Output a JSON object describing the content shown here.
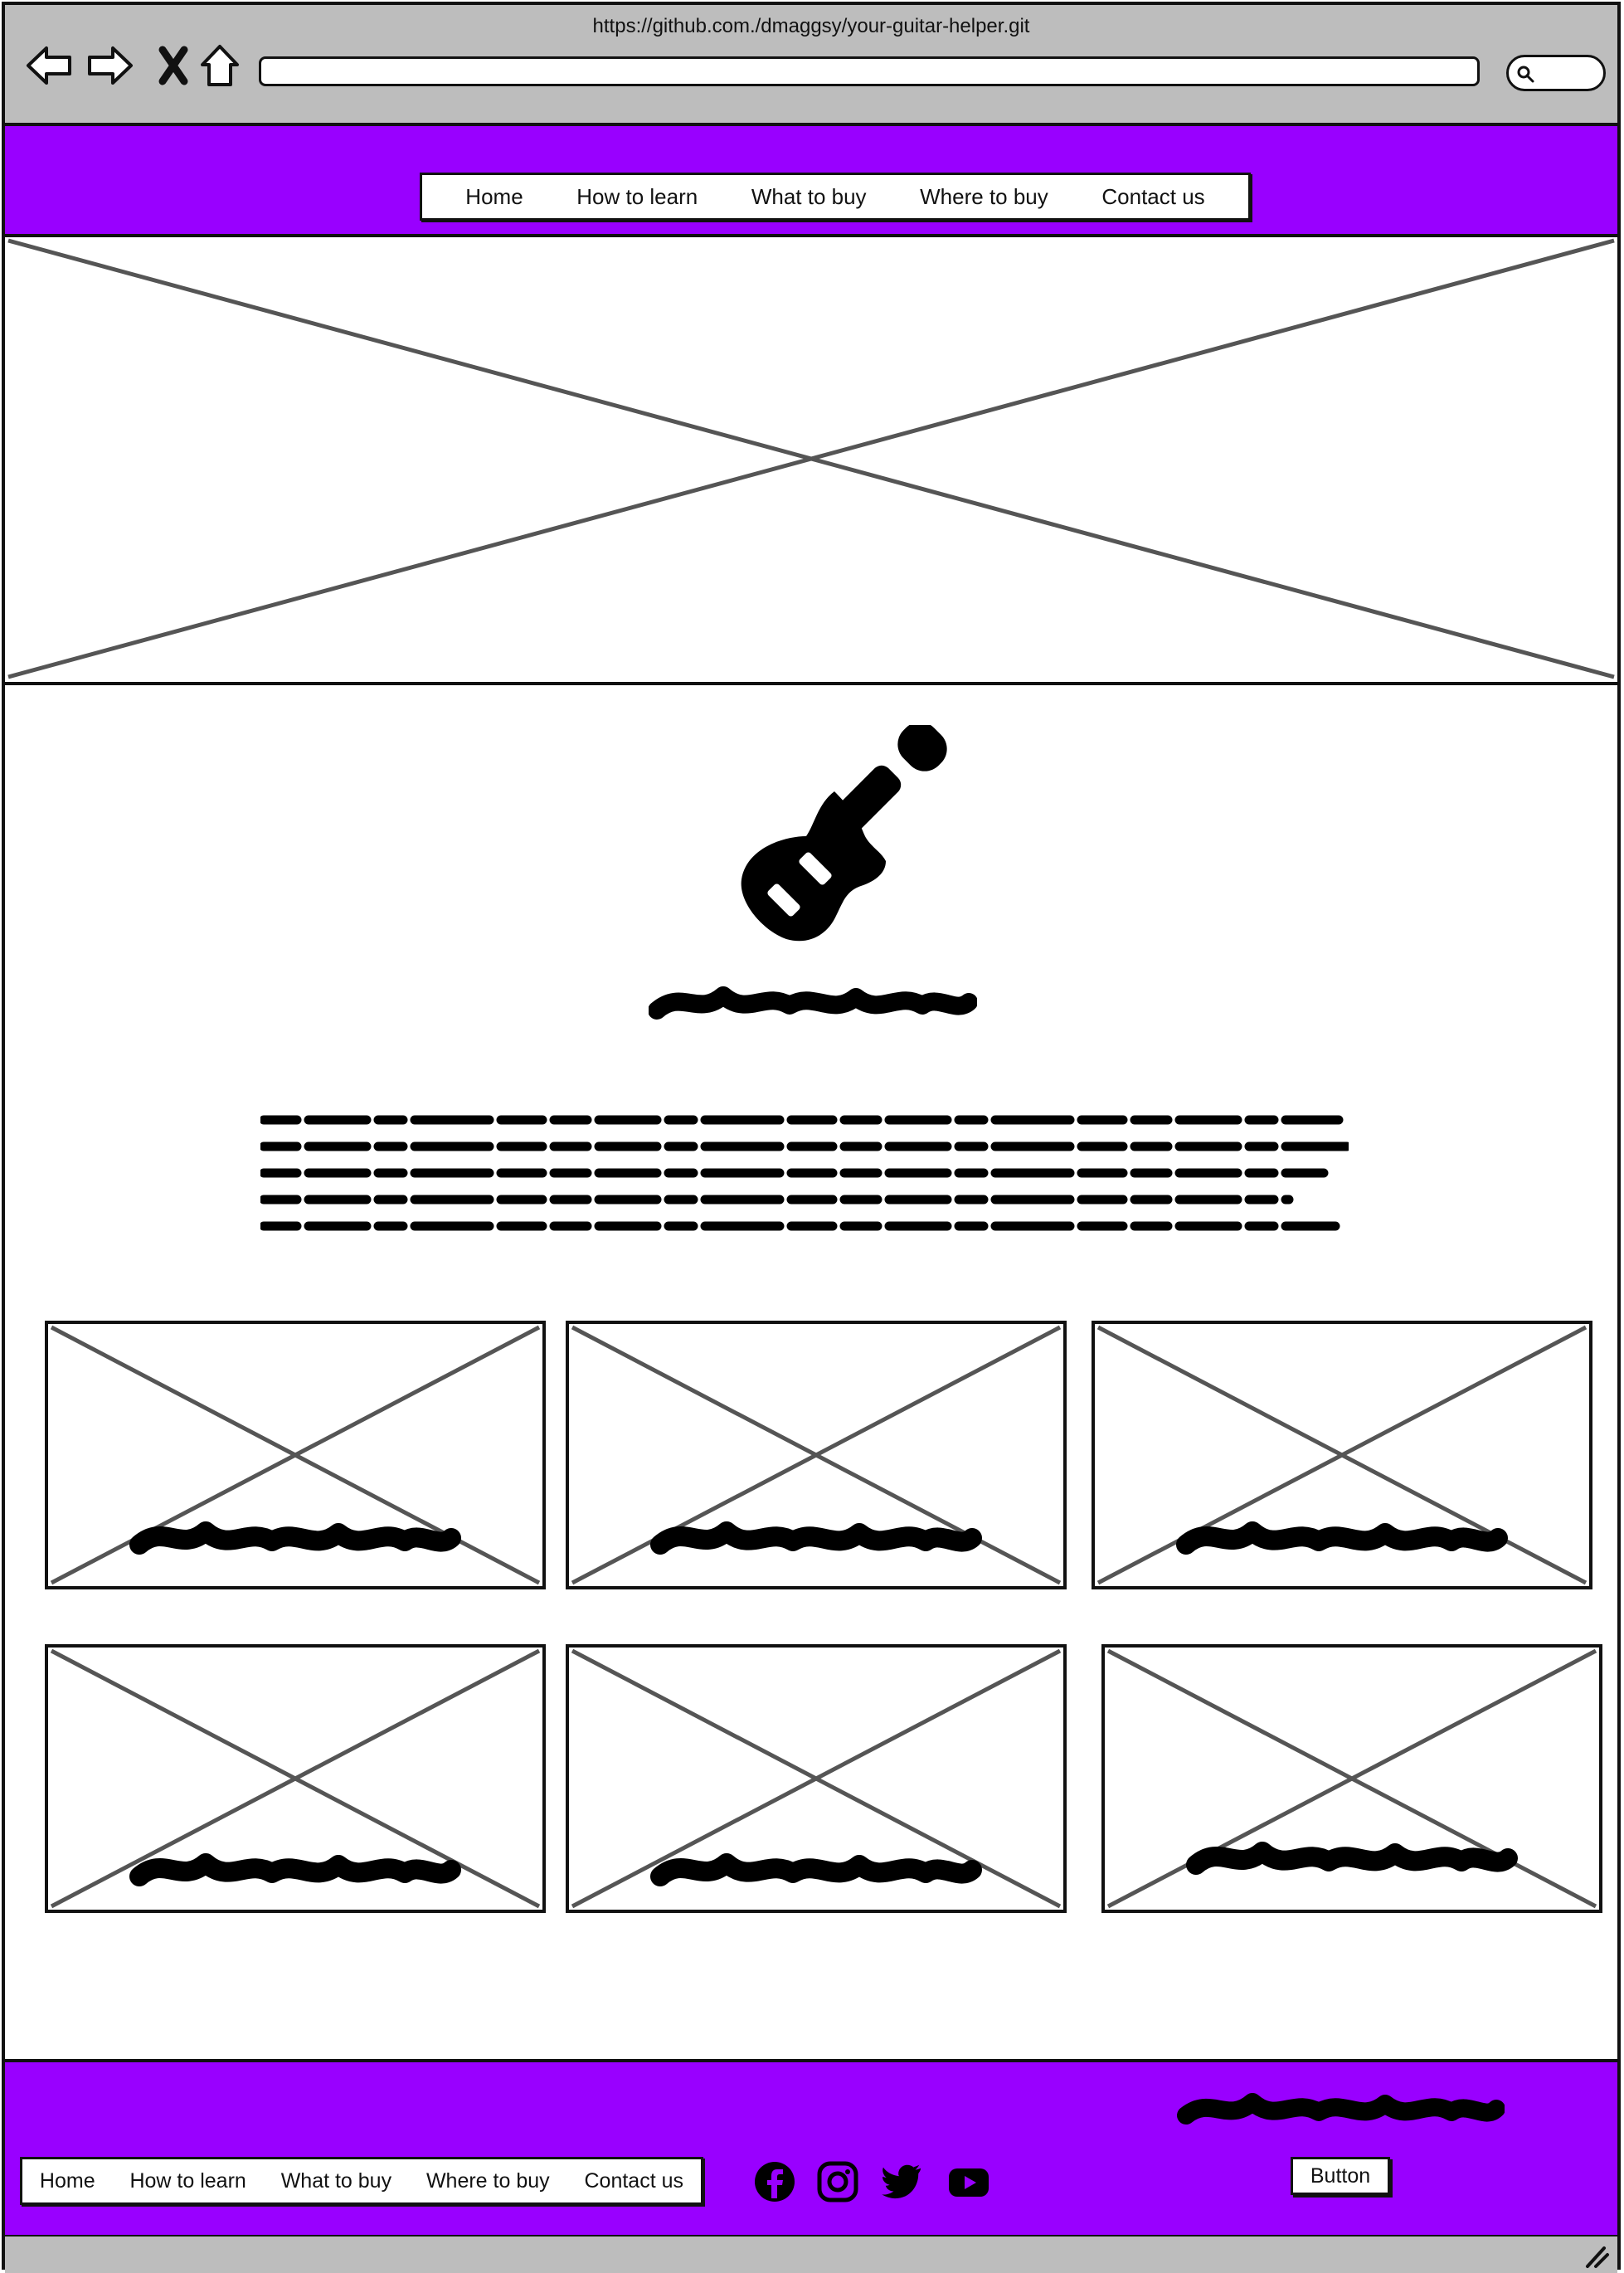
{
  "browser": {
    "url": "https://github.com./dmaggsy/your-guitar-helper.git",
    "icons": [
      "back-arrow-icon",
      "forward-arrow-icon",
      "stop-icon",
      "home-icon",
      "search-icon"
    ]
  },
  "header": {
    "nav": [
      "Home",
      "How to learn",
      "What to buy",
      "Where to buy",
      "Contact us"
    ]
  },
  "main": {
    "logo_icon": "guitar-icon",
    "cards_count_visible": 6
  },
  "footer": {
    "nav": [
      "Home",
      "How to learn",
      "What to buy",
      "Where to buy",
      "Contact us"
    ],
    "social_icons": [
      "facebook-icon",
      "instagram-icon",
      "twitter-icon",
      "youtube-icon"
    ],
    "button_label": "Button"
  },
  "colors": {
    "brand": "#9900ff",
    "chrome": "#bdbdbd",
    "ink": "#111111",
    "placeholder_line": "#555555"
  }
}
